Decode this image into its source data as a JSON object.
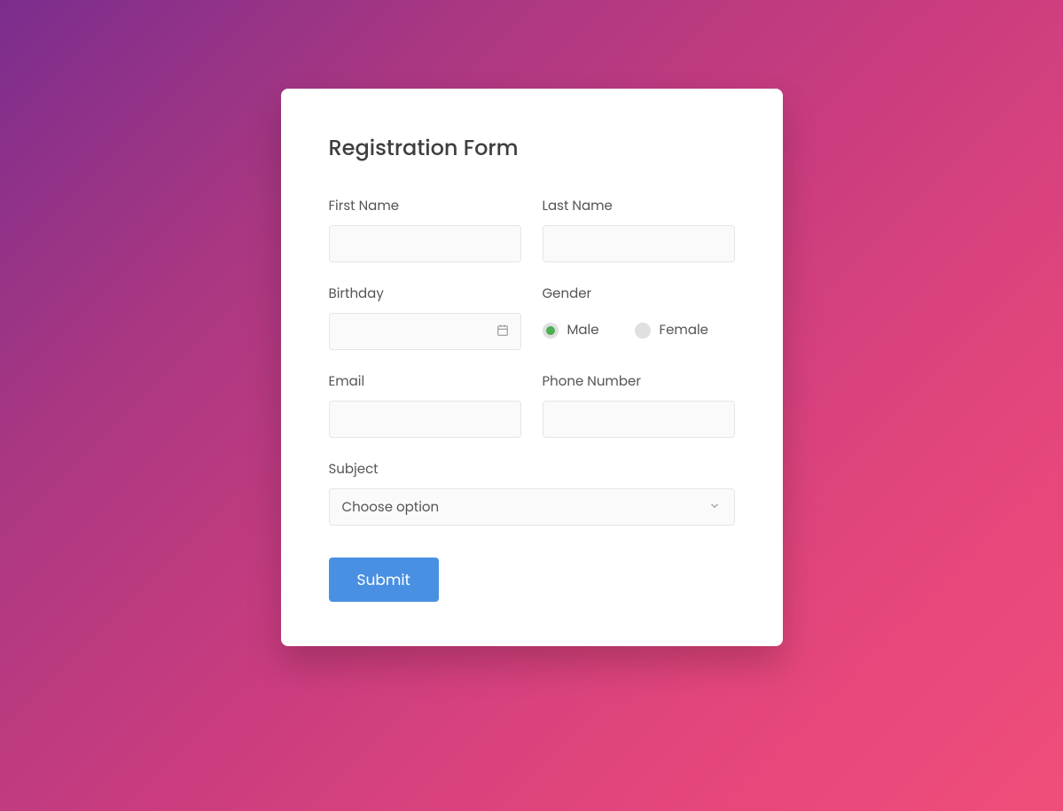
{
  "form": {
    "title": "Registration Form",
    "fields": {
      "firstName": {
        "label": "First Name",
        "value": ""
      },
      "lastName": {
        "label": "Last Name",
        "value": ""
      },
      "birthday": {
        "label": "Birthday",
        "value": ""
      },
      "gender": {
        "label": "Gender",
        "options": {
          "male": "Male",
          "female": "Female"
        },
        "selected": "male"
      },
      "email": {
        "label": "Email",
        "value": ""
      },
      "phone": {
        "label": "Phone Number",
        "value": ""
      },
      "subject": {
        "label": "Subject",
        "placeholder": "Choose option"
      }
    },
    "submit": "Submit"
  }
}
